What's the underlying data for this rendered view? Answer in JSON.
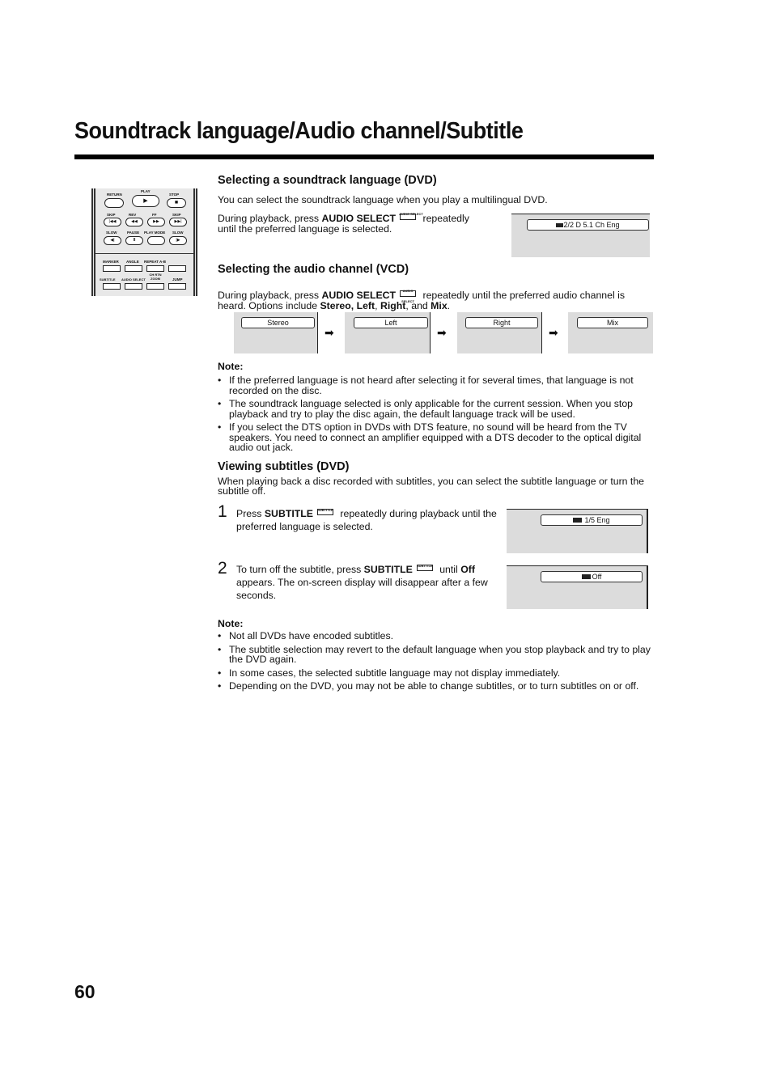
{
  "page": {
    "title": "Soundtrack language/Audio channel/Subtitle",
    "page_number": "60"
  },
  "remote": {
    "labels": {
      "return": "RETURN",
      "play": "PLAY",
      "stop": "STOP",
      "skip_back": "SKIP",
      "rev": "REV",
      "ff": "FF",
      "skip_fwd": "SKIP",
      "slow_back": "SLOW",
      "pause": "PAUSE",
      "play_mode": "PLAY MODE",
      "slow_fwd": "SLOW",
      "marker": "MARKER",
      "angle": "ANGLE",
      "repeat": "REPEAT A-B",
      "subtitle": "SUBTITLE",
      "audio_select": "AUDIO SELECT",
      "ch_rtn_zoom": "CH RTN ZOOM",
      "jump": "JUMP"
    },
    "glyphs": {
      "play": "▶",
      "stop": "■",
      "skip_back": "|◀◀",
      "rev": "◀◀",
      "ff": "▶▶",
      "skip_fwd": "▶▶|",
      "slow_back": "◀|",
      "pause": "II",
      "slow_fwd": "|▶"
    }
  },
  "soundtrack": {
    "heading": "Selecting a soundtrack language (DVD)",
    "intro": "You can select the soundtrack language when you play a multilingual DVD.",
    "line1_pre": "During playback, press ",
    "line1_bold": "AUDIO SELECT",
    "line1_post": " repeatedly",
    "line2": "until the preferred language is selected.",
    "button_icon_label": "AUDIO SELECT",
    "osd_text": "2/2  D 5.1 Ch Eng"
  },
  "audio_channel": {
    "heading": "Selecting the audio channel (VCD)",
    "text_pre": "During playback, press ",
    "text_bold": "AUDIO SELECT",
    "text_mid": " repeatedly until the preferred audio channel is heard. Options include ",
    "opt1": "Stereo, Left",
    "sep1": ", ",
    "opt2": "Right",
    "sep2": ", and ",
    "opt3": "Mix",
    "end": ".",
    "screens": [
      "Stereo",
      "Left",
      "Right",
      "Mix"
    ],
    "arrow_glyph": "➡"
  },
  "note1": {
    "heading": "Note:",
    "items": [
      "If the preferred language is not heard after selecting it for several times, that language is not recorded on the disc.",
      "The soundtrack language selected is only applicable for the current session. When you stop playback and try to play the disc again, the default language track will be used.",
      "If you select the DTS option in DVDs with DTS feature, no sound will be heard from the TV speakers. You need to connect an amplifier equipped with a DTS decoder to the optical digital audio out jack."
    ]
  },
  "subtitles": {
    "heading": "Viewing subtitles (DVD)",
    "intro": "When playing back a disc recorded with subtitles, you can select the subtitle language or turn the subtitle off.",
    "button_icon_label": "SUBTITLE",
    "steps": [
      {
        "num": "1",
        "pre": "Press ",
        "bold": "SUBTITLE",
        "post": " repeatedly during playback until the preferred language is selected.",
        "osd_text": "1/5 Eng"
      },
      {
        "num": "2",
        "pre": "To turn off the subtitle, press ",
        "bold": "SUBTITLE",
        "mid": " until ",
        "bold2": "Off",
        "post": " appears. The on-screen display will disappear after a few seconds.",
        "osd_text": "Off"
      }
    ]
  },
  "note2": {
    "heading": "Note:",
    "items": [
      "Not all DVDs have encoded subtitles.",
      "The subtitle selection may revert to the default language when you stop playback and try to play the DVD again.",
      "In some cases, the selected subtitle language may not display immediately.",
      "Depending on the DVD, you may not be able to change subtitles, or to turn subtitles on or off."
    ]
  }
}
